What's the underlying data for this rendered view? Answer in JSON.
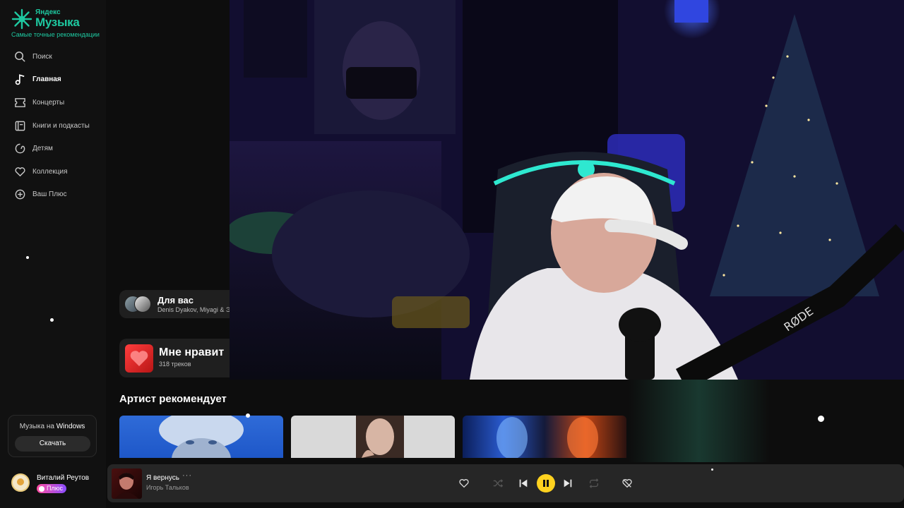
{
  "logo": {
    "brand_small": "Яндекс",
    "brand_big": "Музыка",
    "tagline": "Самые точные рекомендации"
  },
  "sidebar": {
    "items": [
      {
        "label": "Поиск",
        "icon": "search-icon",
        "active": false
      },
      {
        "label": "Главная",
        "icon": "music-note-icon",
        "active": true
      },
      {
        "label": "Концерты",
        "icon": "ticket-icon",
        "active": false
      },
      {
        "label": "Книги и подкасты",
        "icon": "book-icon",
        "active": false
      },
      {
        "label": "Детям",
        "icon": "kids-icon",
        "active": false
      },
      {
        "label": "Коллекция",
        "icon": "heart-icon",
        "active": false
      },
      {
        "label": "Ваш Плюс",
        "icon": "plus-circle-icon",
        "active": false
      }
    ],
    "download": {
      "title_prefix": "Музыка на",
      "title_platform": "Windows",
      "button": "Скачать"
    },
    "user": {
      "name": "Виталий Реутов",
      "plus_label": "Плюс"
    }
  },
  "main": {
    "for_you": {
      "title": "Для вас",
      "subtitle": "Denis Dyakov, Miyagi & Э"
    },
    "likes": {
      "title": "Мне нравит",
      "subtitle": "318 треков"
    },
    "artist_section_title": "Артист рекомендует"
  },
  "player": {
    "track_title": "Я вернусь",
    "more_label": "···",
    "artist": "Игорь Тальков",
    "state": "playing"
  },
  "colors": {
    "accent": "#1ec8a0",
    "play_button": "#ffd21f",
    "plus_gradient_start": "#ff4fa3",
    "plus_gradient_end": "#8a4dff"
  }
}
